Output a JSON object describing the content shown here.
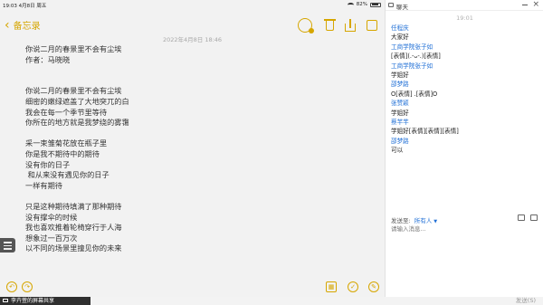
{
  "status": {
    "time": "19:03",
    "date": "4月8日 周五",
    "battery": "82%"
  },
  "notes": {
    "back_label": "备忘录",
    "date": "2022年4月8日 18:46",
    "body": "你说二月的春景里不会有尘埃\n作者：马晓晓\n\n\n你说二月的春景里不会有尘埃\n细密的嫩绿遮盖了大地突兀的白\n我会在每一个季节里等待\n你所在的地方就是我梦绕的雾霭\n\n采一束雏菊花放在瓶子里\n你是我不期待中的期待\n没有你的日子\n 和从来没有遇见你的日子\n一样有期待\n\n只是这种期待填满了那种期待\n没有撑伞的时候\n我也喜欢推着轮椅穿行于人海\n想象过一百万次\n以不同的场景里撞见你的未来",
    "icons": {
      "share": "share-people-icon",
      "trash": "trash-icon",
      "upload": "share-upload-icon",
      "compose": "compose-icon",
      "undo": "undo-icon",
      "redo": "redo-icon",
      "table": "table-icon",
      "check": "checklist-icon",
      "pen": "markup-pen-icon"
    },
    "accent": "#d6a600"
  },
  "chat": {
    "title": "聊天",
    "time": "19:01",
    "messages": [
      {
        "sender": "任程庆",
        "text": "大家好"
      },
      {
        "sender": "工商学院张子如",
        "text": "[表情](.-ᴗ-.)[表情]"
      },
      {
        "sender": "工商学院张子如",
        "text": "学姐好"
      },
      {
        "sender": "邵梦路",
        "text": "O[表情] .[表情]O"
      },
      {
        "sender": "张赞颖",
        "text": "学姐好"
      },
      {
        "sender": "蔡芊芊",
        "text": "学姐好[表情][表情][表情]"
      },
      {
        "sender": "邵梦路",
        "text": "可以"
      }
    ],
    "sendto_label": "发送至:",
    "sendto_value": "所有人",
    "input_placeholder": "请输入消息...",
    "send_label": "发送(S)",
    "link_color": "#1f6fd6"
  },
  "share_status": "李卉萱的屏幕共享"
}
